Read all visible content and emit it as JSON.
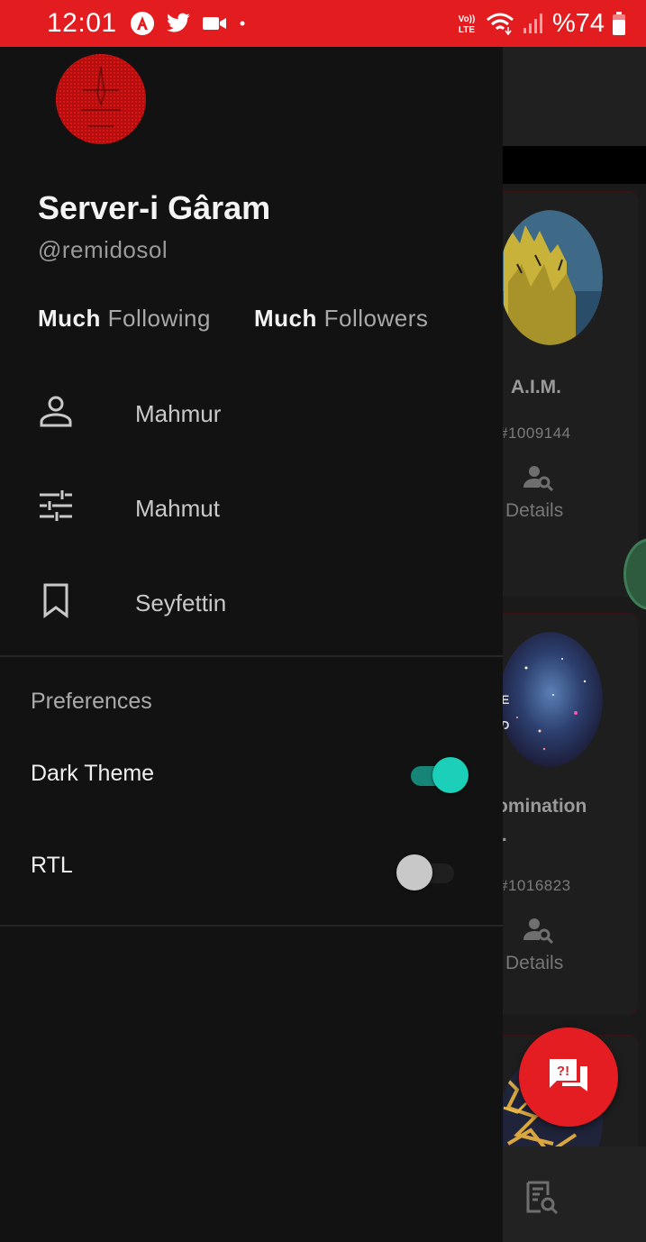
{
  "status_bar": {
    "time": "12:01",
    "left_icons": [
      "angular-icon",
      "twitter-icon",
      "video-camera-icon",
      "dot-icon"
    ],
    "volte": "Vo))\nLTE",
    "battery_text": "%74",
    "bar_color": "#e31c1f"
  },
  "drawer": {
    "profile": {
      "name": "Server-i Gâram",
      "handle": "@remidosol",
      "following_count": "Much",
      "following_label": "Following",
      "followers_count": "Much",
      "followers_label": "Followers"
    },
    "menu": [
      {
        "icon": "person-icon",
        "label": "Mahmur"
      },
      {
        "icon": "tune-sliders-icon",
        "label": "Mahmut"
      },
      {
        "icon": "bookmark-icon",
        "label": "Seyfettin"
      }
    ],
    "preferences": {
      "heading": "Preferences",
      "dark_theme": {
        "label": "Dark Theme",
        "on": true
      },
      "rtl": {
        "label": "RTL",
        "on": false
      }
    }
  },
  "background": {
    "cards": [
      {
        "title": "A.I.M.",
        "id": "#1009144",
        "action": "Details"
      },
      {
        "title": "omination",
        "title_extra": "..",
        "overlay_letters": [
          "E",
          "D"
        ],
        "id": "#1016823",
        "action": "Details"
      }
    ],
    "accent_color": "#e41d22",
    "switch_color": "#1ccfb8"
  }
}
